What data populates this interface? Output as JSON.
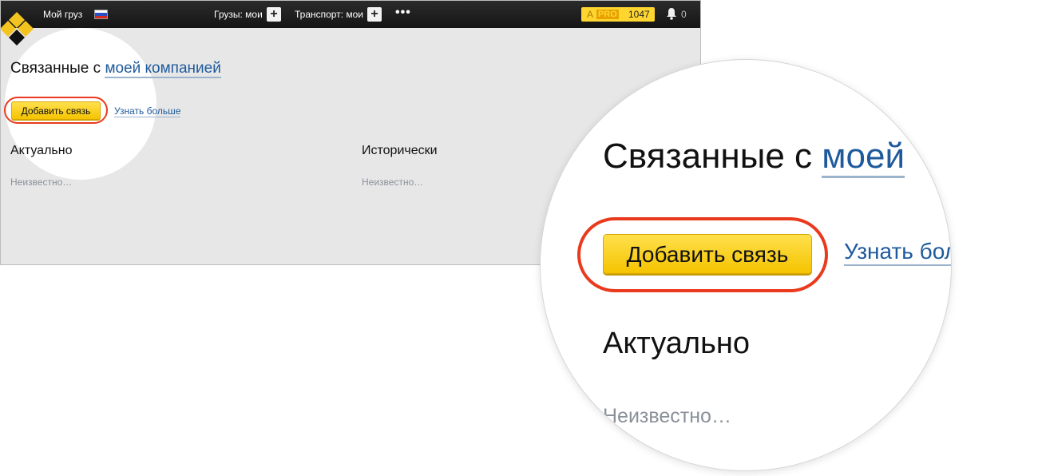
{
  "topbar": {
    "my_cargo": "Мой груз",
    "cargo_menu": "Грузы: мои",
    "transport_menu": "Транспорт: мои",
    "plus": "+",
    "more": "•••",
    "pro_badge": {
      "prefix": "A",
      "label": "PRO",
      "count": "1047"
    },
    "notifications_count": "0",
    "icons": [
      "logo-diamond-icon",
      "russia-flag-icon",
      "plus-icon",
      "more-dots-icon",
      "bell-icon"
    ]
  },
  "page": {
    "title_prefix": "Связанные с",
    "title_link": "моей компанией",
    "add_button": "Добавить связь",
    "learn_more": "Узнать больше",
    "columns": [
      {
        "title": "Актуально",
        "empty": "Неизвестно…"
      },
      {
        "title": "Исторически",
        "empty": "Неизвестно…"
      }
    ]
  },
  "magnifier": {
    "title_prefix": "Связанные с",
    "title_link": "моей",
    "add_button": "Добавить связь",
    "learn_more": "Узнать бол",
    "column_title": "Актуально",
    "empty": "Неизвестно…"
  },
  "colors": {
    "accent_yellow": "#ffd530",
    "link_blue": "#1e5a9c",
    "highlight_red": "#ea3a1e",
    "topbar": "#1c1c1c"
  }
}
